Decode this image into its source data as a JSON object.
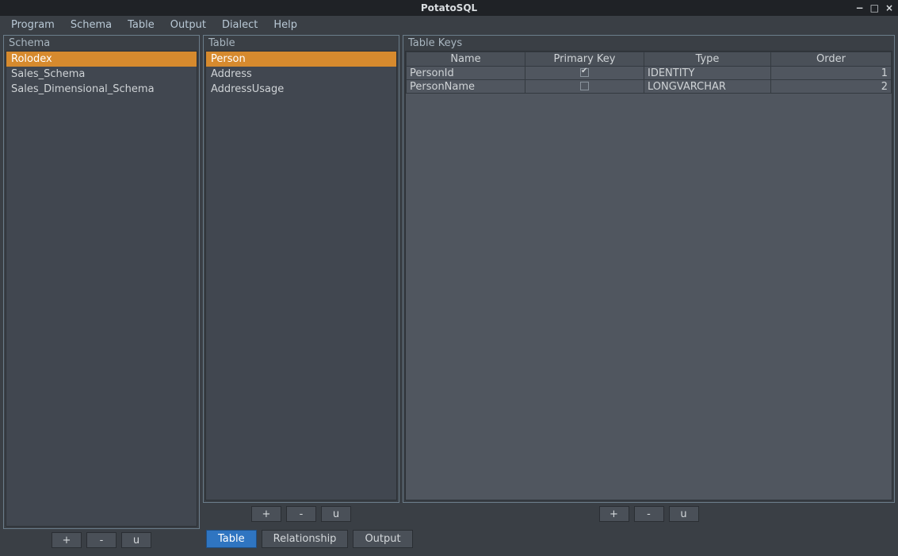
{
  "window": {
    "title": "PotatoSQL"
  },
  "menubar": [
    "Program",
    "Schema",
    "Table",
    "Output",
    "Dialect",
    "Help"
  ],
  "schema_panel": {
    "title": "Schema",
    "items": [
      {
        "label": "Rolodex",
        "selected": true
      },
      {
        "label": "Sales_Schema",
        "selected": false
      },
      {
        "label": "Sales_Dimensional_Schema",
        "selected": false
      }
    ],
    "buttons": {
      "add": "+",
      "remove": "-",
      "update": "u"
    }
  },
  "table_panel": {
    "title": "Table",
    "items": [
      {
        "label": "Person",
        "selected": true
      },
      {
        "label": "Address",
        "selected": false
      },
      {
        "label": "AddressUsage",
        "selected": false
      }
    ],
    "buttons": {
      "add": "+",
      "remove": "-",
      "update": "u"
    }
  },
  "keys_panel": {
    "title": "Table Keys",
    "columns": [
      "Name",
      "Primary Key",
      "Type",
      "Order"
    ],
    "rows": [
      {
        "name": "PersonId",
        "pk": true,
        "type": "IDENTITY",
        "order": "1"
      },
      {
        "name": "PersonName",
        "pk": false,
        "type": "LONGVARCHAR",
        "order": "2"
      }
    ],
    "buttons": {
      "add": "+",
      "remove": "-",
      "update": "u"
    }
  },
  "tabs": [
    {
      "label": "Table",
      "active": true
    },
    {
      "label": "Relationship",
      "active": false
    },
    {
      "label": "Output",
      "active": false
    }
  ]
}
